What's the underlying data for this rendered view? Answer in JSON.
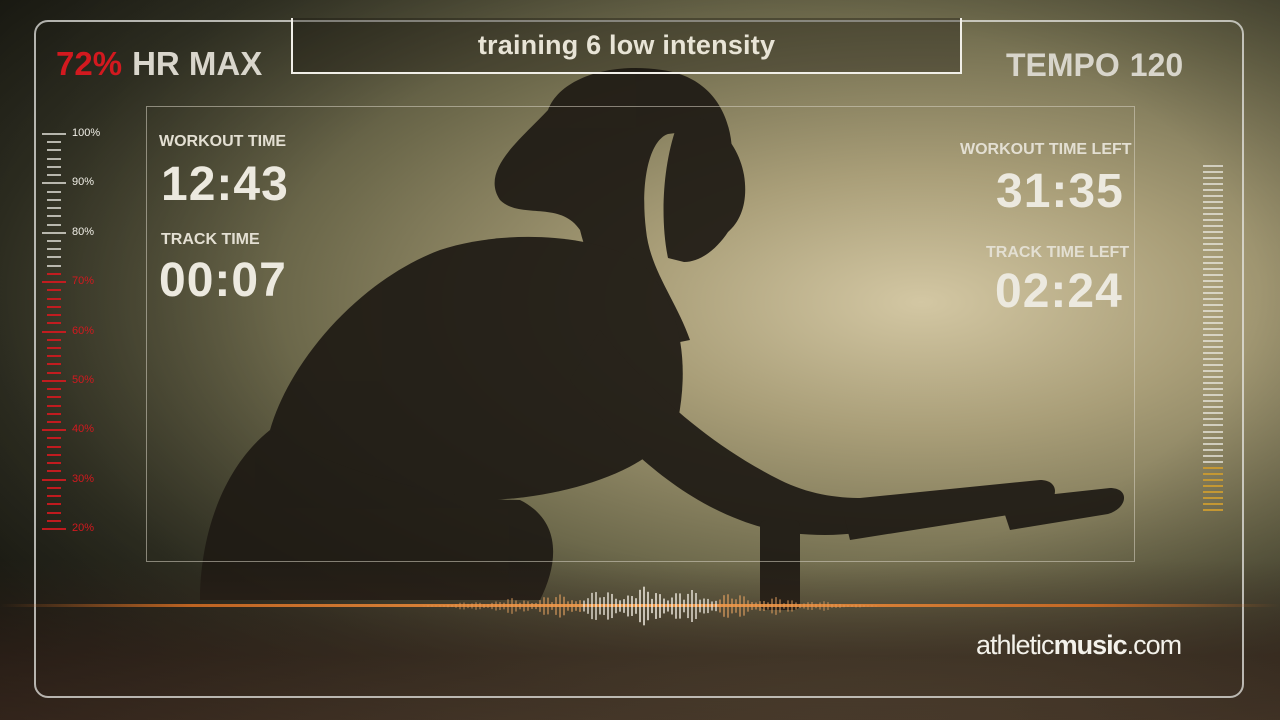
{
  "hud": {
    "hr_percent": "72%",
    "hr_label": "HR MAX",
    "title": "training 6 low intensity",
    "tempo_label": "TEMPO",
    "tempo_value": "120"
  },
  "timers": {
    "workout_time_label": "WORKOUT TIME",
    "workout_time_value": "12:43",
    "track_time_label": "TRACK TIME",
    "track_time_value": "00:07",
    "workout_time_left_label": "WORKOUT TIME LEFT",
    "workout_time_left_value": "31:35",
    "track_time_left_label": "TRACK TIME LEFT",
    "track_time_left_value": "02:24"
  },
  "hr_scale": {
    "labels": [
      "100%",
      "90%",
      "80%",
      "70%",
      "60%",
      "50%",
      "40%",
      "30%",
      "20%"
    ],
    "current_percent": 72,
    "active_color": "#d2191f",
    "inactive_color": "#e6e4dc"
  },
  "intensity_bar": {
    "level": 0.14,
    "active_color": "#c89a32",
    "inactive_color": "#ecebe4"
  },
  "branding": {
    "logo_prefix": "athletic",
    "logo_bold": "music",
    "logo_suffix": ".com"
  }
}
